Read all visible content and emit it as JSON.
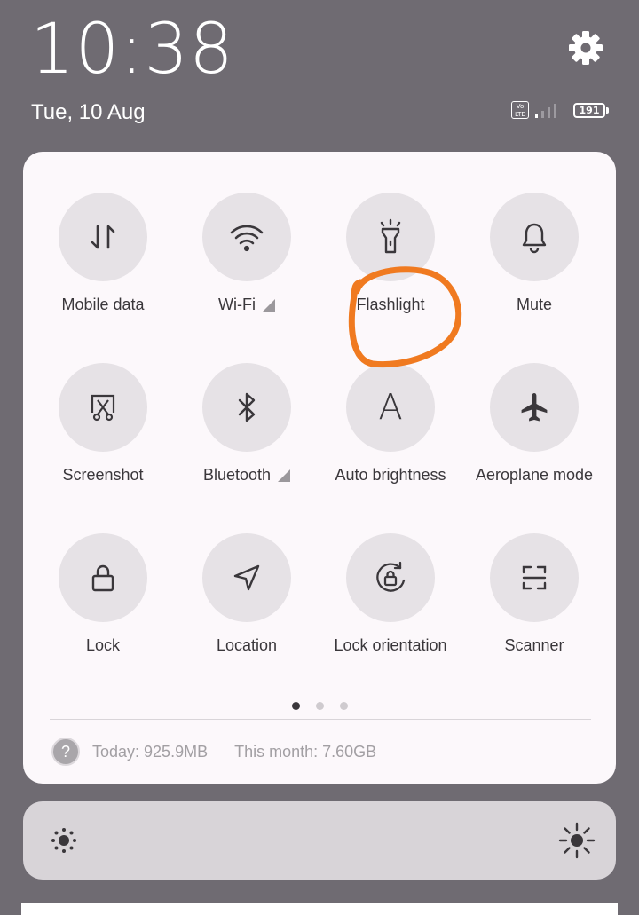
{
  "status": {
    "time": "10:38",
    "date": "Tue, 10 Aug",
    "volte": "Vo LTE",
    "battery": "191"
  },
  "tiles": [
    {
      "label": "Mobile data",
      "icon": "mobile-data-icon"
    },
    {
      "label": "Wi-Fi",
      "icon": "wifi-icon",
      "has_expand": true
    },
    {
      "label": "Flashlight",
      "icon": "flashlight-icon"
    },
    {
      "label": "Mute",
      "icon": "bell-icon"
    },
    {
      "label": "Screenshot",
      "icon": "screenshot-icon"
    },
    {
      "label": "Bluetooth",
      "icon": "bluetooth-icon",
      "has_expand": true
    },
    {
      "label": "Auto brightness",
      "icon": "auto-brightness-icon",
      "glyph": "A"
    },
    {
      "label": "Aeroplane mode",
      "icon": "airplane-icon"
    },
    {
      "label": "Lock",
      "icon": "lock-icon"
    },
    {
      "label": "Location",
      "icon": "location-icon"
    },
    {
      "label": "Lock orientation",
      "icon": "rotation-lock-icon"
    },
    {
      "label": "Scanner",
      "icon": "scanner-icon"
    }
  ],
  "pager": {
    "pages": 3,
    "active": 1
  },
  "usage": {
    "help_glyph": "?",
    "today": "Today: 925.9MB",
    "month": "This month: 7.60GB"
  },
  "colors": {
    "backdrop": "#6f6b72",
    "panel": "#fcf8fb",
    "tile_circle": "#e6e2e6",
    "annotation": "#f07a20"
  }
}
